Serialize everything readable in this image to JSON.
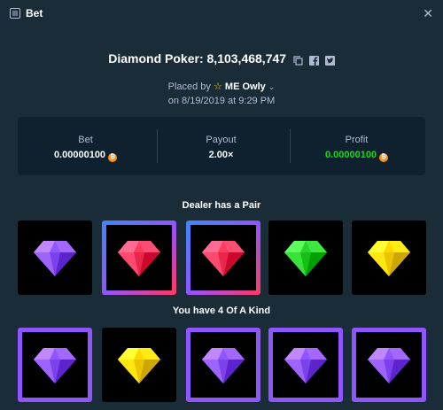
{
  "window": {
    "title": "Bet",
    "close_icon": "close-icon"
  },
  "bet": {
    "game": "Diamond Poker:",
    "id": "8,103,468,747",
    "placed_prefix": "Placed by",
    "user": "ME Owly",
    "date": "on 8/19/2019 at 9:29 PM"
  },
  "stats": {
    "bet_label": "Bet",
    "bet_value": "0.00000100",
    "payout_label": "Payout",
    "payout_value": "2.00×",
    "profit_label": "Profit",
    "profit_value": "0.00000100",
    "profit_color": "#00e701",
    "currency_icon": "bitcoin-icon"
  },
  "dealer": {
    "label": "Dealer has a Pair",
    "gems": [
      "purple",
      "red",
      "red",
      "green",
      "yellow"
    ]
  },
  "player": {
    "label": "You have 4 Of A Kind",
    "gems": [
      "purple",
      "yellow",
      "purple",
      "purple",
      "purple"
    ]
  },
  "colors": {
    "purple": "#8f55ff",
    "red": "#ff3a5f",
    "blue": "#3e86ff",
    "green": "#2bd22b",
    "yellow": "#ffd800"
  }
}
